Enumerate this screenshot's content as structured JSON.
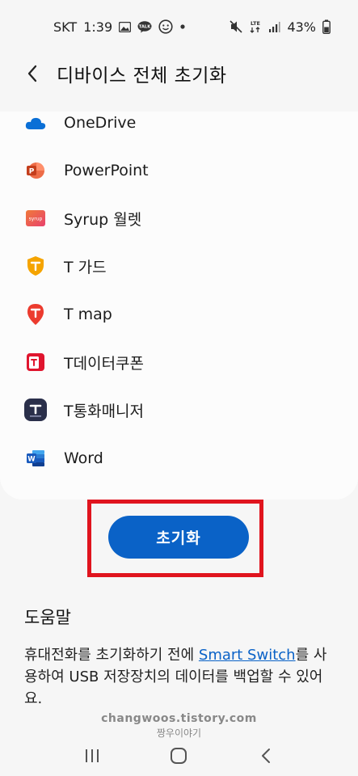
{
  "status_bar": {
    "carrier": "SKT",
    "time": "1:39",
    "battery": "43%",
    "network": "LTE",
    "icons": [
      "image-icon",
      "talk-icon",
      "face-icon",
      "dot-icon",
      "mute-icon",
      "lte-icon",
      "signal-icon",
      "battery-icon"
    ],
    "talk_badge": "TALK"
  },
  "header": {
    "title": "디바이스 전체 초기화",
    "back_icon": "chevron-left-icon"
  },
  "apps": [
    {
      "label": "OneDrive",
      "icon": "onedrive-icon"
    },
    {
      "label": "PowerPoint",
      "icon": "powerpoint-icon",
      "badge": "P"
    },
    {
      "label": "Syrup 월렛",
      "icon": "syrup-icon",
      "badge": "syrup"
    },
    {
      "label": "T 가드",
      "icon": "tguard-icon"
    },
    {
      "label": "T map",
      "icon": "tmap-icon"
    },
    {
      "label": "T데이터쿠폰",
      "icon": "tdatacoupon-icon"
    },
    {
      "label": "T통화매니저",
      "icon": "tcallmanager-icon"
    },
    {
      "label": "Word",
      "icon": "word-icon",
      "badge": "W"
    }
  ],
  "reset_button": {
    "label": "초기화"
  },
  "help": {
    "title": "도움말",
    "text_before": "휴대전화를 초기화하기 전에 ",
    "link": "Smart Switch",
    "text_after": "를 사용하여 USB 저장장치의 데이터를 백업할 수 있어요."
  },
  "watermark": {
    "line1": "changwoos.tistory.com",
    "line2": "짱우이야기"
  },
  "nav": {
    "recent": "recent-apps-icon",
    "home": "home-icon",
    "back": "back-icon"
  },
  "colors": {
    "accent": "#0a62c7",
    "highlight_border": "#e0141e",
    "background": "#f6f6f6",
    "card": "#fcfcfc"
  }
}
